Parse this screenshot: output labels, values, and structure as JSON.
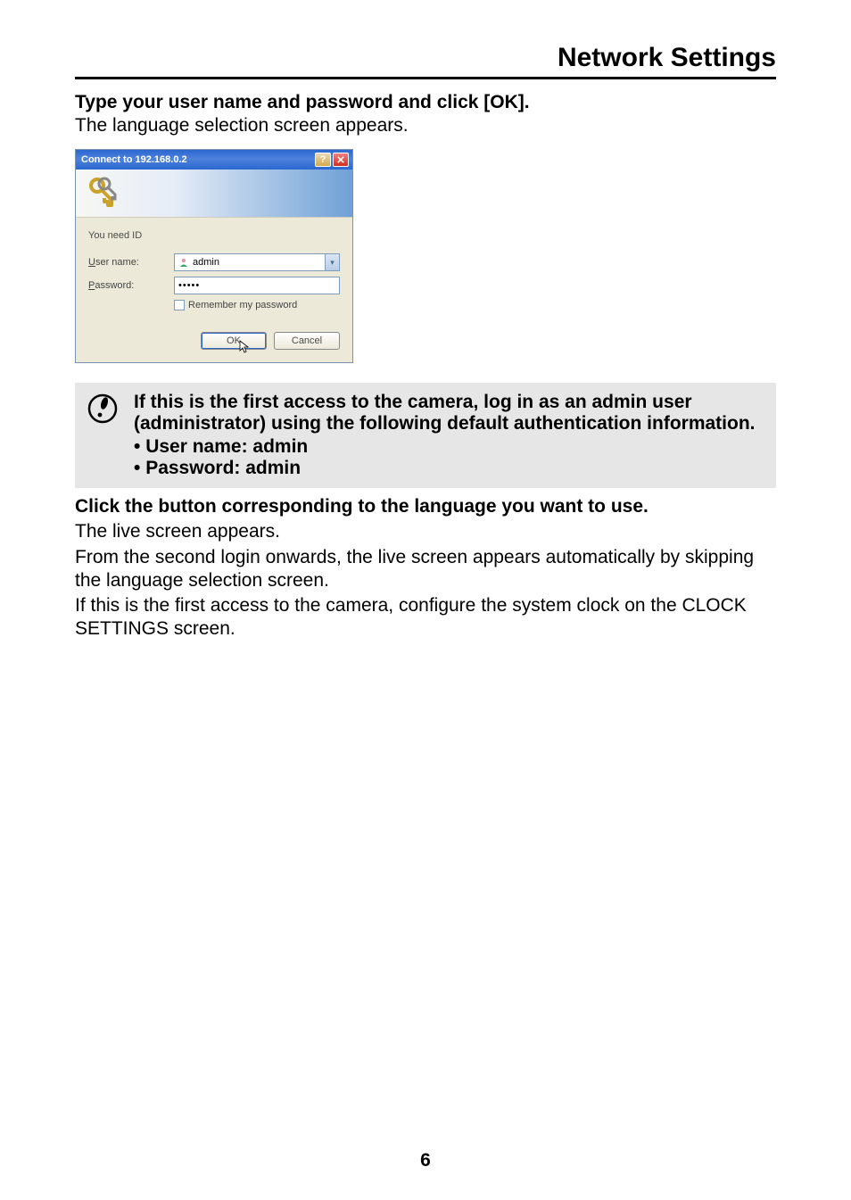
{
  "header": {
    "title": "Network Settings"
  },
  "step1": {
    "bold": "Type your user name and password and click [OK].",
    "plain": "The language selection screen appears."
  },
  "dialog": {
    "title": "Connect to 192.168.0.2",
    "prompt": "You need ID",
    "user_label_pre": "U",
    "user_label_rest": "ser name:",
    "user_value": "admin",
    "pass_label_pre": "P",
    "pass_label_rest": "assword:",
    "pass_value": "•••••",
    "remember_pre": "R",
    "remember_rest": "emember my password",
    "ok": "OK",
    "cancel": "Cancel"
  },
  "note": {
    "line1": "If this is the first access to the camera, log in as an admin user (administrator) using the following default authentication information.",
    "bullet1": "User name: admin",
    "bullet2": "Password: admin"
  },
  "step2": {
    "bold": "Click the button corresponding to the language you want to use.",
    "p1": "The live screen appears.",
    "p2": "From the second login onwards, the live screen appears automatically by skipping the language selection screen.",
    "p3": "If this is the first access to the camera, configure the system clock on the CLOCK SETTINGS screen."
  },
  "page_number": "6"
}
